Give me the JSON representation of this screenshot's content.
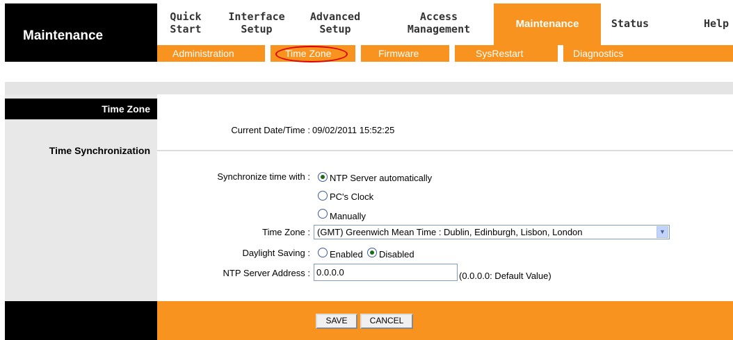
{
  "header": {
    "brand": "Maintenance",
    "nav": [
      {
        "line1": "Quick",
        "line2": "Start"
      },
      {
        "line1": "Interface",
        "line2": "Setup"
      },
      {
        "line1": "Advanced",
        "line2": "Setup"
      },
      {
        "line1": "Access",
        "line2": "Management"
      },
      {
        "label": "Maintenance",
        "active": true
      },
      {
        "label": "Status"
      },
      {
        "label": "Help"
      }
    ],
    "subnav": [
      "Administration",
      "Time Zone",
      "Firmware",
      "SysRestart",
      "Diagnostics"
    ]
  },
  "sections": {
    "time_zone": "Time Zone",
    "time_sync": "Time Synchronization"
  },
  "current": {
    "label": "Current Date/Time :",
    "value": "09/02/2011 15:52:25"
  },
  "sync": {
    "label": "Synchronize time with :",
    "options": [
      "NTP Server automatically",
      "PC's Clock",
      "Manually"
    ],
    "selected": "NTP Server automatically"
  },
  "timezone": {
    "label": "Time Zone :",
    "value": "(GMT) Greenwich Mean Time : Dublin, Edinburgh, Lisbon, London"
  },
  "daylight": {
    "label": "Daylight Saving :",
    "enabled": "Enabled",
    "disabled": "Disabled",
    "selected": "Disabled"
  },
  "ntp": {
    "label": "NTP Server Address :",
    "value": "0.0.0.0",
    "hint": "(0.0.0.0: Default Value)"
  },
  "buttons": {
    "save": "SAVE",
    "cancel": "CANCEL"
  },
  "colors": {
    "accent": "#f7931e",
    "dark": "#000000",
    "highlight": "#e00000"
  }
}
